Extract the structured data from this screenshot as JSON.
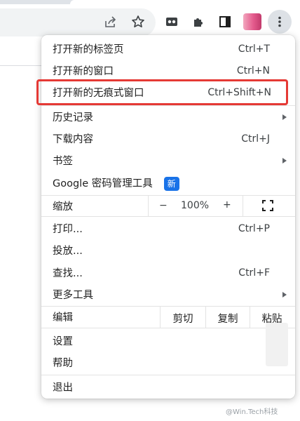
{
  "menu": {
    "new_tab": {
      "label": "打开新的标签页",
      "shortcut": "Ctrl+T"
    },
    "new_window": {
      "label": "打开新的窗口",
      "shortcut": "Ctrl+N"
    },
    "new_incognito": {
      "label": "打开新的无痕式窗口",
      "shortcut": "Ctrl+Shift+N"
    },
    "history": {
      "label": "历史记录"
    },
    "downloads": {
      "label": "下载内容",
      "shortcut": "Ctrl+J"
    },
    "bookmarks": {
      "label": "书签"
    },
    "password_manager": {
      "label": "Google 密码管理工具",
      "badge": "新"
    },
    "zoom": {
      "label": "缩放",
      "minus": "−",
      "level": "100%",
      "plus": "+"
    },
    "print": {
      "label": "打印...",
      "shortcut": "Ctrl+P"
    },
    "cast": {
      "label": "投放..."
    },
    "find": {
      "label": "查找...",
      "shortcut": "Ctrl+F"
    },
    "more_tools": {
      "label": "更多工具"
    },
    "edit": {
      "label": "编辑",
      "cut": "剪切",
      "copy": "复制",
      "paste": "粘贴"
    },
    "settings": {
      "label": "设置"
    },
    "help": {
      "label": "帮助"
    },
    "exit": {
      "label": "退出"
    }
  },
  "watermark": "@Win.Tech科技",
  "colors": {
    "highlight": "#e53935",
    "badge": "#1a73e8"
  },
  "icons": [
    "share-icon",
    "bookmark-star-icon",
    "tab-search-icon",
    "extensions-icon",
    "side-panel-icon",
    "avatar",
    "more-vert-icon",
    "fullscreen-icon"
  ]
}
